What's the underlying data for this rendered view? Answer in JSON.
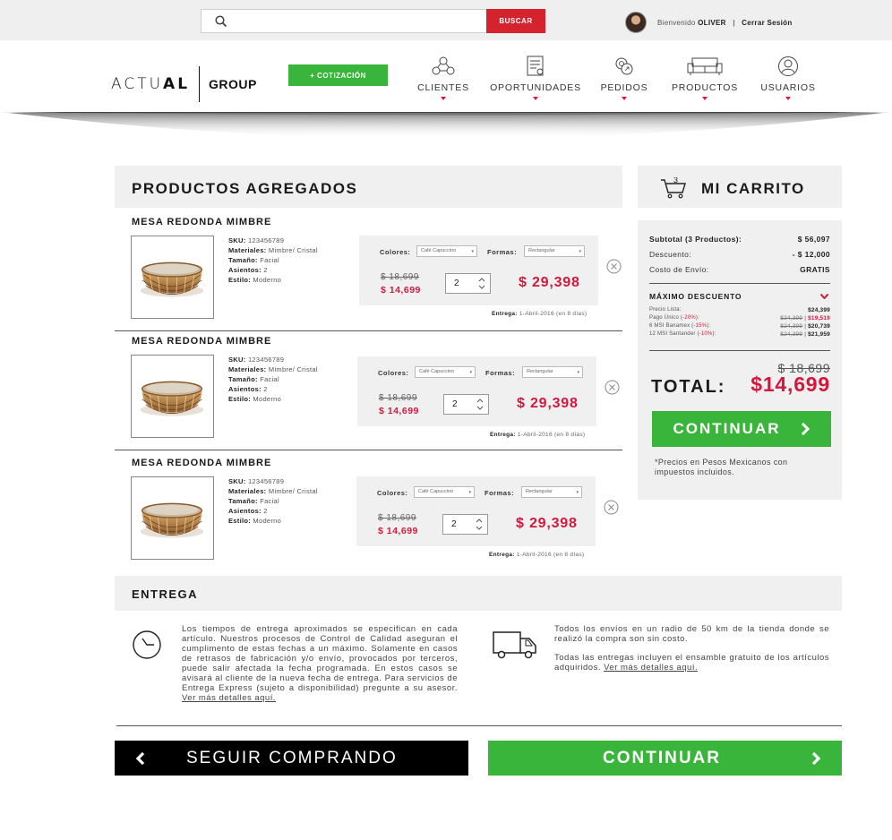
{
  "topbar": {
    "search_placeholder": "",
    "search_button": "BUSCAR",
    "welcome_prefix": "Bienvenido",
    "user_name": "OLIVER",
    "separator": "|",
    "logout": "Cerrar Sesión"
  },
  "header": {
    "logo_actual_light": "ACTU",
    "logo_actual_bold": "AL",
    "logo_group": "GROUP",
    "cotizacion_button": "+ COTIZACIÓN",
    "nav": [
      {
        "label": "CLIENTES",
        "icon": "clients-icon"
      },
      {
        "label": "OPORTUNIDADES",
        "icon": "document-icon"
      },
      {
        "label": "PEDIDOS",
        "icon": "orders-icon"
      },
      {
        "label": "PRODUCTOS",
        "icon": "sofa-icon"
      },
      {
        "label": "USUARIOS",
        "icon": "user-icon"
      }
    ]
  },
  "products": {
    "title": "PRODUCTOS AGREGADOS",
    "spec_labels": {
      "sku": "SKU:",
      "materials": "Materiales:",
      "size": "Tamaño:",
      "seats": "Asientos:",
      "style": "Estilo:"
    },
    "colors_label": "Colores:",
    "shapes_label": "Formas:",
    "delivery_label": "Entrega:",
    "items": [
      {
        "name": "MESA REDONDA MIMBRE",
        "sku": "123456789",
        "materials": "Mimbre/ Cristal",
        "size": "Facial",
        "seats": "2",
        "style": "Moderno",
        "color": "Café Capuccino",
        "shape": "Rectangular",
        "old_price": "$ 18,699",
        "price": "$ 14,699",
        "qty": "2",
        "total": "$ 29,398",
        "delivery": "1-Abril-2016 (en 8 días)"
      },
      {
        "name": "MESA REDONDA MIMBRE",
        "sku": "123456789",
        "materials": "Mimbre/ Cristal",
        "size": "Facial",
        "seats": "2",
        "style": "Moderno",
        "color": "Café Capuccino",
        "shape": "Rectangular",
        "old_price": "$ 18,699",
        "price": "$ 14,699",
        "qty": "2",
        "total": "$ 29,398",
        "delivery": "1-Abril-2016 (en 8 días)"
      },
      {
        "name": "MESA REDONDA MIMBRE",
        "sku": "123456789",
        "materials": "Mimbre/ Cristal",
        "size": "Facial",
        "seats": "2",
        "style": "Moderno",
        "color": "Café Capuccino",
        "shape": "Rectangular",
        "old_price": "$ 18,699",
        "price": "$ 14,699",
        "qty": "2",
        "total": "$ 29,398",
        "delivery": "1-Abril-2016 (en 8 días)"
      }
    ]
  },
  "cart": {
    "title": "MI CARRITO",
    "count": "3",
    "subtotal_label": "Subtotal (3 Productos):",
    "subtotal": "$ 56,097",
    "discount_label": "Descuento:",
    "discount": "- $ 12,000",
    "shipping_label": "Costo de Envío:",
    "shipping": "GRATIS",
    "max_discount_title": "MÁXIMO DESCUENTO",
    "list_price_label": "Precio Lista:",
    "list_price": "$24,399",
    "rows": [
      {
        "label": "Pago Único",
        "pct": "-20%",
        "old": "$24,399",
        "new": "$19,519"
      },
      {
        "label": "6 MSI Banamex",
        "pct": "-15%",
        "old": "$24,399",
        "new": "$20,739"
      },
      {
        "label": "12 MSI Santander",
        "pct": "-10%",
        "old": "$24,399",
        "new": "$21,959"
      }
    ],
    "old_total": "$ 18,699",
    "total_label": "TOTAL:",
    "total": "$14,699",
    "continue": "CONTINUAR",
    "note": "*Precios en Pesos Mexicanos con impuestos incluidos."
  },
  "entrega": {
    "title": "ENTREGA",
    "text_left": "Los tiempos de entrega aproximados se especifican en cada artículo. Nuestros procesos de Control de Calidad aseguran el cumplimento de estas fechas a un máximo. Solamente en casos de retrasos de fabricación y/o envío, provocados por terceros, puede salir afectada la fecha programada. En estos casos se avisará al cliente de la nueva fecha de entrega. Para servicios de Entrega Express (sujeto a disponibilidad) pregunte a su asesor.",
    "link_left": "Ver más detalles aquí.",
    "text_right_1": "Todos los envíos en un radio de 50 km de la tienda donde se realizó la compra son sin costo.",
    "text_right_2": "Todas las entregas incluyen el ensamble gratuito de los artículos adquiridos.",
    "link_right": "Ver más detalles aquí."
  },
  "footer": {
    "keep_shopping": "SEGUIR COMPRANDO",
    "continue": "CONTINUAR"
  },
  "colors": {
    "accent_red": "#d4232e",
    "price_red": "#d4183d",
    "green": "#38b53a",
    "panel_gray": "#f0f0f0"
  }
}
